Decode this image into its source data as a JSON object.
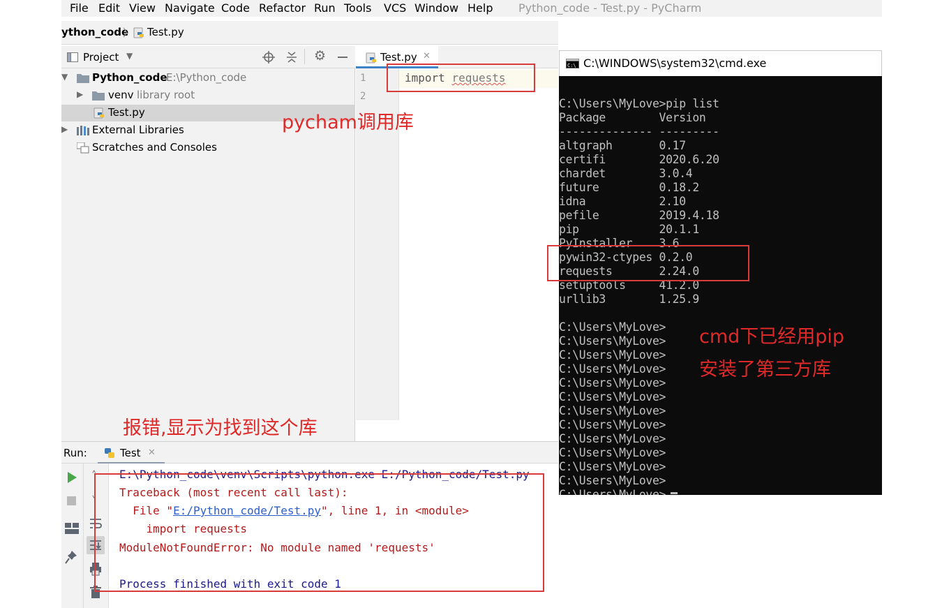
{
  "menu": {
    "items": [
      "File",
      "Edit",
      "View",
      "Navigate",
      "Code",
      "Refactor",
      "Run",
      "Tools",
      "VCS",
      "Window",
      "Help"
    ],
    "window_title": "Python_code - Test.py - PyCharm"
  },
  "breadcrumb": {
    "project": "ython_code",
    "file": "Test.py"
  },
  "project_panel": {
    "title": "Project",
    "tree": [
      {
        "name": "Python_code",
        "hint": "E:\\Python_code"
      },
      {
        "name": "venv",
        "hint": "library root"
      },
      {
        "name": "Test.py"
      },
      {
        "name": "External Libraries"
      },
      {
        "name": "Scratches and Consoles"
      }
    ]
  },
  "editor": {
    "tab": "Test.py",
    "line_numbers": [
      "1",
      "2"
    ],
    "code_keyword": "import",
    "code_module": "requests"
  },
  "run_panel": {
    "label": "Run:",
    "tab": "Test",
    "console": {
      "cmd": "E:\\Python_code\\venv\\Scripts\\python.exe E:/Python_code/Test.py",
      "traceback": "Traceback (most recent call last):",
      "file_prefix": "  File \"",
      "file_link": "E:/Python_code/Test.py",
      "file_suffix": "\", line 1, in <module>",
      "import_line": "    import requests",
      "error": "ModuleNotFoundError: No module named 'requests'",
      "finished": "Process finished with exit code 1"
    }
  },
  "cmd_window": {
    "title": "C:\\WINDOWS\\system32\\cmd.exe",
    "lines": [
      "",
      "C:\\Users\\MyLove>pip list",
      "Package        Version",
      "-------------- ---------",
      "altgraph       0.17",
      "certifi        2020.6.20",
      "chardet        3.0.4",
      "future         0.18.2",
      "idna           2.10",
      "pefile         2019.4.18",
      "pip            20.1.1",
      "PyInstaller    3.6",
      "pywin32-ctypes 0.2.0",
      "requests       2.24.0",
      "setuptools     41.2.0",
      "urllib3        1.25.9",
      "",
      "C:\\Users\\MyLove>",
      "C:\\Users\\MyLove>",
      "C:\\Users\\MyLove>",
      "C:\\Users\\MyLove>",
      "C:\\Users\\MyLove>",
      "C:\\Users\\MyLove>",
      "C:\\Users\\MyLove>",
      "C:\\Users\\MyLove>",
      "C:\\Users\\MyLove>",
      "C:\\Users\\MyLove>",
      "C:\\Users\\MyLove>",
      "C:\\Users\\MyLove>",
      "C:\\Users\\MyLove>"
    ]
  },
  "annotations": {
    "pycharm": "pycham调用库",
    "cmd_line1": "cmd下已经用pip",
    "cmd_line2": "安装了第三方库",
    "error": "报错,显示为找到这个库"
  },
  "colors": {
    "annotation_red": "#e02a2a",
    "cmd_background": "#0c0c0c",
    "tab_underline": "#4083c9"
  }
}
